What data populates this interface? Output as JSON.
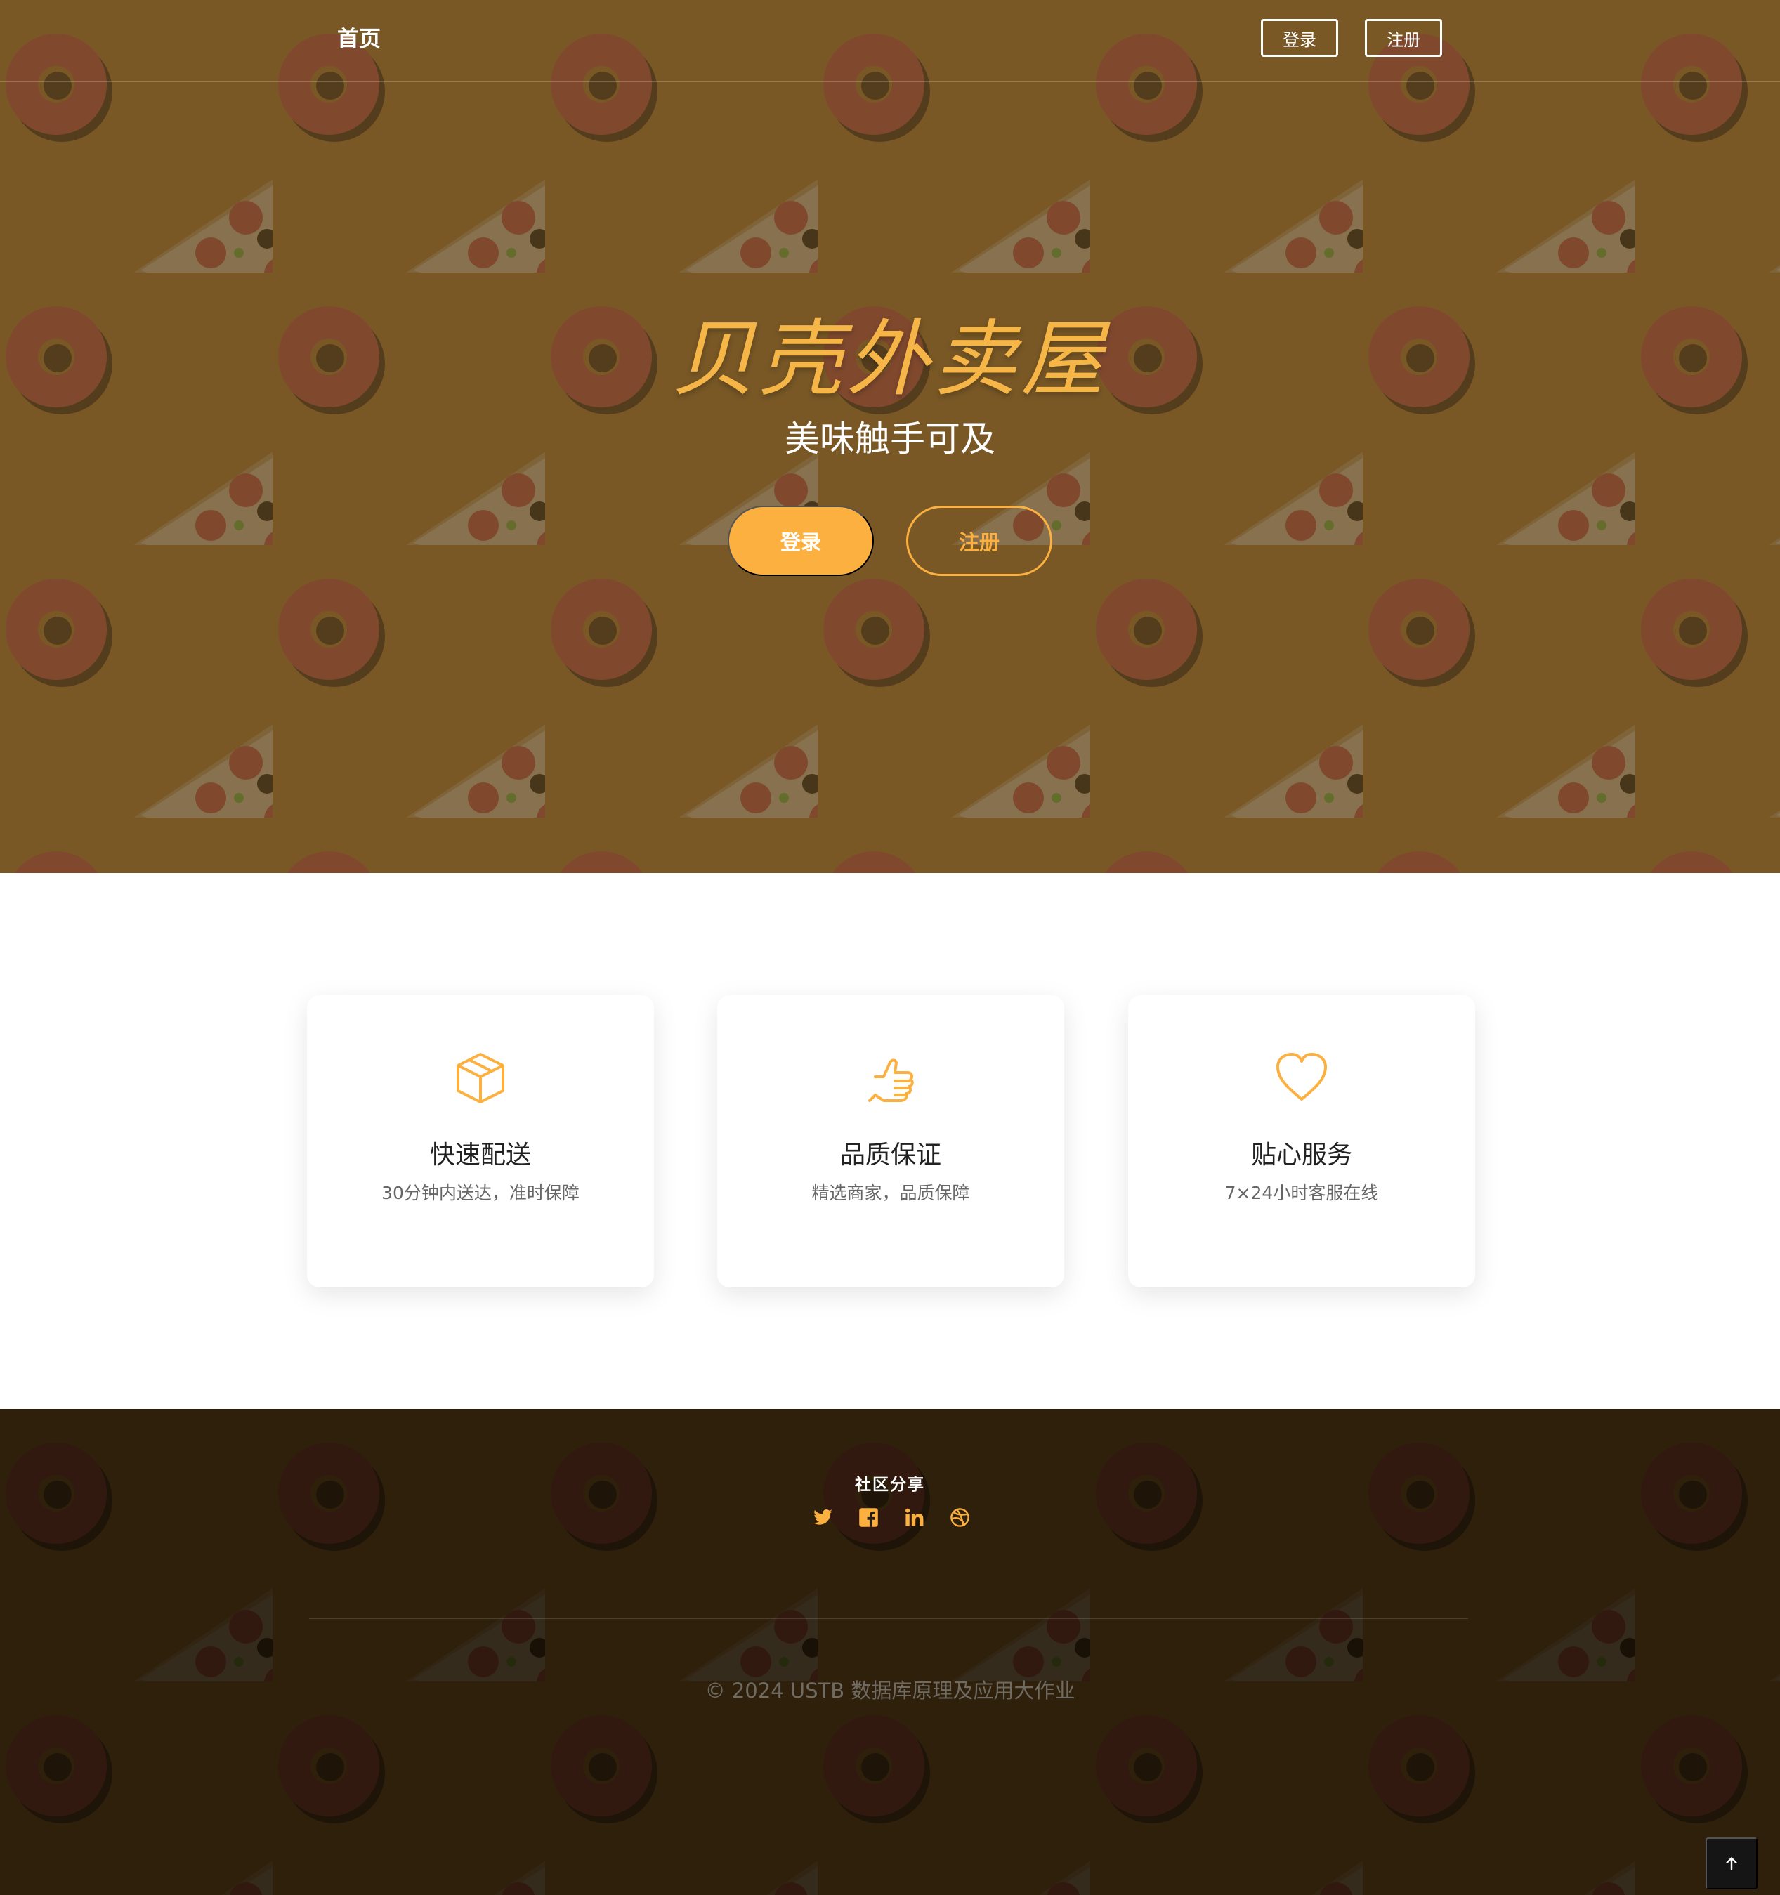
{
  "nav": {
    "home_label": "首页",
    "login_label": "登录",
    "register_label": "注册"
  },
  "hero": {
    "brand": "贝壳外卖屋",
    "tagline": "美味触手可及",
    "login_label": "登录",
    "register_label": "注册"
  },
  "features": [
    {
      "icon": "box-icon",
      "title": "快速配送",
      "desc": "30分钟内送达，准时保障"
    },
    {
      "icon": "thumbs-up-icon",
      "title": "品质保证",
      "desc": "精选商家，品质保障"
    },
    {
      "icon": "heart-icon",
      "title": "贴心服务",
      "desc": "7×24小时客服在线"
    }
  ],
  "footer": {
    "share_title": "社区分享",
    "social_icons": [
      "twitter-icon",
      "facebook-icon",
      "linkedin-icon",
      "dribbble-icon"
    ],
    "copyright": "© 2024 USTB 数据库原理及应用大作业"
  },
  "colors": {
    "accent": "#fbb040",
    "hero_bg": "#7a5a2a",
    "donut": "#8d3b3d",
    "footer_overlay": "#1c1204"
  }
}
